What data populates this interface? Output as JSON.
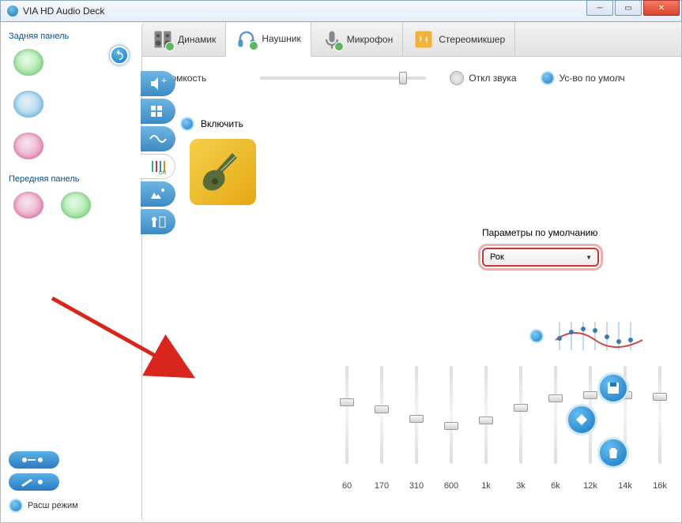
{
  "window": {
    "title": "VIA HD Audio Deck"
  },
  "left": {
    "rear_label": "Задняя панель",
    "front_label": "Передняя панель",
    "expand_label": "Расш режим"
  },
  "tabs": {
    "speaker": "Динамик",
    "headphone": "Наушник",
    "mic": "Микрофон",
    "stereomix": "Стереомикшер"
  },
  "volume": {
    "label": "Громкость",
    "mute": "Откл звука",
    "default_device": "Ус-во по умолч",
    "slider_percent": 88
  },
  "eq": {
    "enable": "Включить",
    "presets_label": "Параметры по умолчанию",
    "preset_selected": "Рок",
    "bands": [
      {
        "freq": "60",
        "pos": 36
      },
      {
        "freq": "170",
        "pos": 44
      },
      {
        "freq": "310",
        "pos": 54
      },
      {
        "freq": "600",
        "pos": 62
      },
      {
        "freq": "1k",
        "pos": 56
      },
      {
        "freq": "3k",
        "pos": 42
      },
      {
        "freq": "6k",
        "pos": 32
      },
      {
        "freq": "12k",
        "pos": 28
      },
      {
        "freq": "14k",
        "pos": 28
      },
      {
        "freq": "16k",
        "pos": 30
      }
    ]
  }
}
